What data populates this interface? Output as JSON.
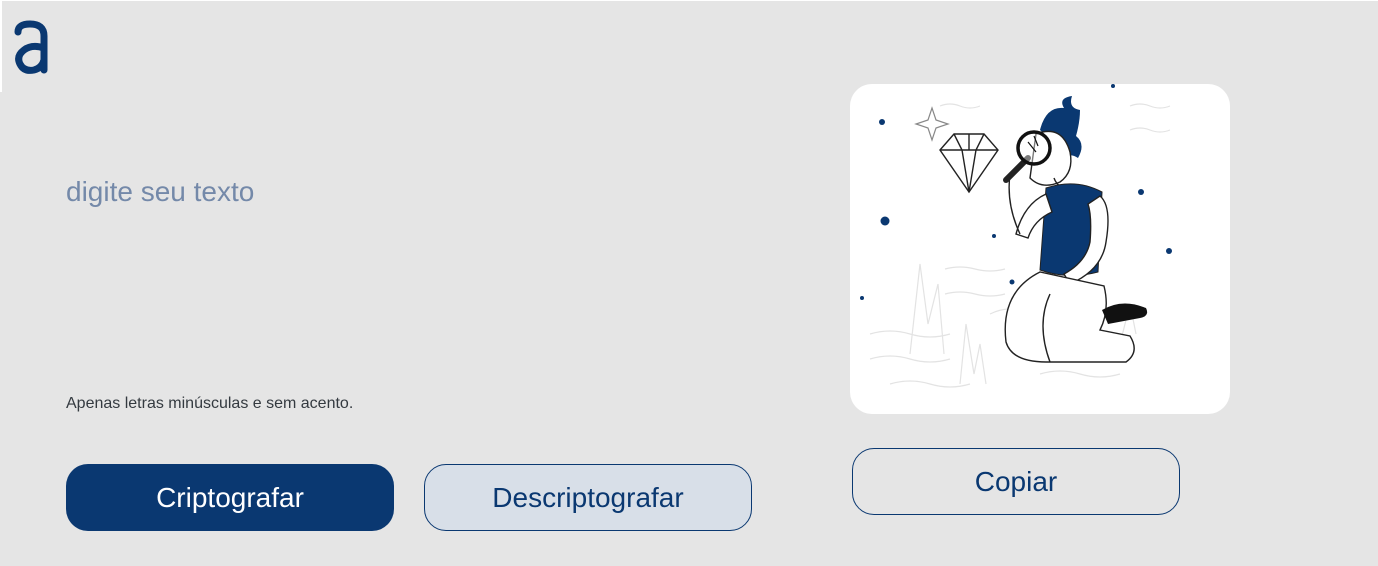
{
  "brand": {
    "logo_glyph": "a",
    "logo_color": "#0a3871"
  },
  "input": {
    "placeholder": "digite seu texto",
    "value": ""
  },
  "hint": {
    "text": "Apenas letras minúsculas e sem acento."
  },
  "buttons": {
    "encrypt_label": "Criptografar",
    "decrypt_label": "Descriptografar",
    "copy_label": "Copiar"
  },
  "illustration": {
    "subject": "person-with-magnifying-glass-looking-at-diamond"
  },
  "colors": {
    "background": "#e5e5e5",
    "primary": "#0a3871",
    "secondary_button": "#d8dfe8",
    "placeholder": "#7489a9",
    "card": "#ffffff"
  }
}
